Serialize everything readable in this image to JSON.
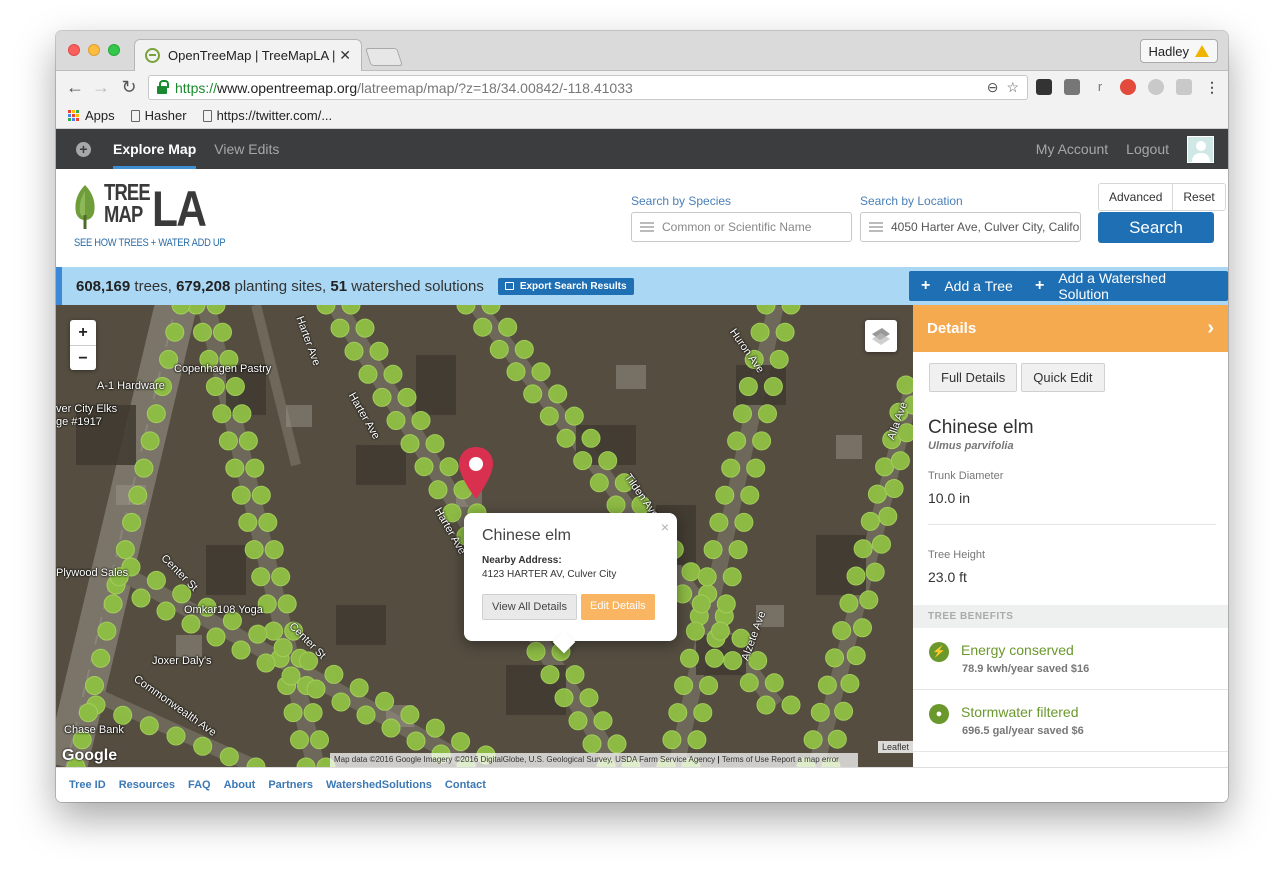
{
  "browser": {
    "tab_title": "OpenTreeMap | TreeMapLA | M",
    "profile_name": "Hadley",
    "url_scheme": "https://",
    "url_host": "www.opentreemap.org",
    "url_path": "/latreemap/map/?z=18/34.00842/-118.41033",
    "bookmarks": [
      {
        "label": "Apps",
        "icon": "apps-icon"
      },
      {
        "label": "Hasher",
        "icon": "page-icon"
      },
      {
        "label": "https://twitter.com/...",
        "icon": "page-icon"
      }
    ]
  },
  "topnav": {
    "explore": "Explore Map",
    "view_edits": "View Edits",
    "my_account": "My Account",
    "logout": "Logout"
  },
  "logo": {
    "line1": "TREE",
    "line2": "MAP",
    "la": "LA",
    "tagline": "SEE HOW TREES + WATER ADD UP"
  },
  "search": {
    "species_label": "Search by Species",
    "species_placeholder": "Common or Scientific Name",
    "location_label": "Search by Location",
    "location_value": "4050 Harter Ave, Culver City, Califo",
    "advanced": "Advanced",
    "reset": "Reset",
    "button": "Search"
  },
  "stats": {
    "trees_count": "608,169",
    "trees_word": " trees, ",
    "sites_count": "679,208",
    "sites_word": " planting sites, ",
    "watershed_count": "51",
    "watershed_word": " watershed solutions",
    "export": "Export Search Results",
    "add_tree": "Add a Tree",
    "add_watershed": "Add a Watershed Solution"
  },
  "map": {
    "zoom_in": "+",
    "zoom_out": "−",
    "labels": {
      "copenhagen": "Copenhagen Pastry",
      "a1": "A-1 Hardware",
      "culver_elks": "ver City Elks",
      "lodge": "ge #1917",
      "plywood": "Plywood Sales",
      "omkar": "Omkar108 Yoga",
      "joxer": "Joxer Daly's",
      "chase": "Chase Bank"
    },
    "streets": {
      "harter1": "Harter Ave",
      "harter2": "Harter Ave",
      "harter3": "Harter Ave",
      "tilden": "Tilden Ave",
      "huron": "Huron Ave",
      "center1": "Center St",
      "center2": "Center St",
      "alla": "Alla Ave",
      "alzete": "Alzete Ave",
      "commonwealth": "Commonwealth Ave"
    },
    "attribution": "Map data ©2016 Google Imagery ©2016 DigitalGlobe, U.S. Geological Survey, USDA Farm Service Agency",
    "terms": "Terms of Use",
    "report": "Report a map error",
    "leaflet": "Leaflet",
    "google": "Google",
    "marker_color": "#d9304f",
    "tree_dot_color": "#8fc044"
  },
  "popup": {
    "title": "Chinese elm",
    "close": "×",
    "addr_label": "Nearby Address:",
    "address": "4123 HARTER AV, Culver City",
    "view_all": "View All Details",
    "edit": "Edit Details"
  },
  "details": {
    "header": "Details",
    "full_details": "Full Details",
    "quick_edit": "Quick Edit",
    "common_name": "Chinese elm",
    "scientific_name": "Ulmus parvifolia",
    "trunk_label": "Trunk Diameter",
    "trunk_value": "10.0 in",
    "height_label": "Tree Height",
    "height_value": "23.0 ft",
    "benefits_header": "TREE BENEFITS",
    "benefits": [
      {
        "name": "Energy conserved",
        "value": "78.9 kwh/year saved $16",
        "icon": "lightning-icon"
      },
      {
        "name": "Stormwater filtered",
        "value": "696.5 gal/year saved $6",
        "icon": "drop-icon"
      }
    ]
  },
  "footer": {
    "links": [
      "Tree ID",
      "Resources",
      "FAQ",
      "About",
      "Partners",
      "WatershedSolutions",
      "Contact"
    ]
  }
}
